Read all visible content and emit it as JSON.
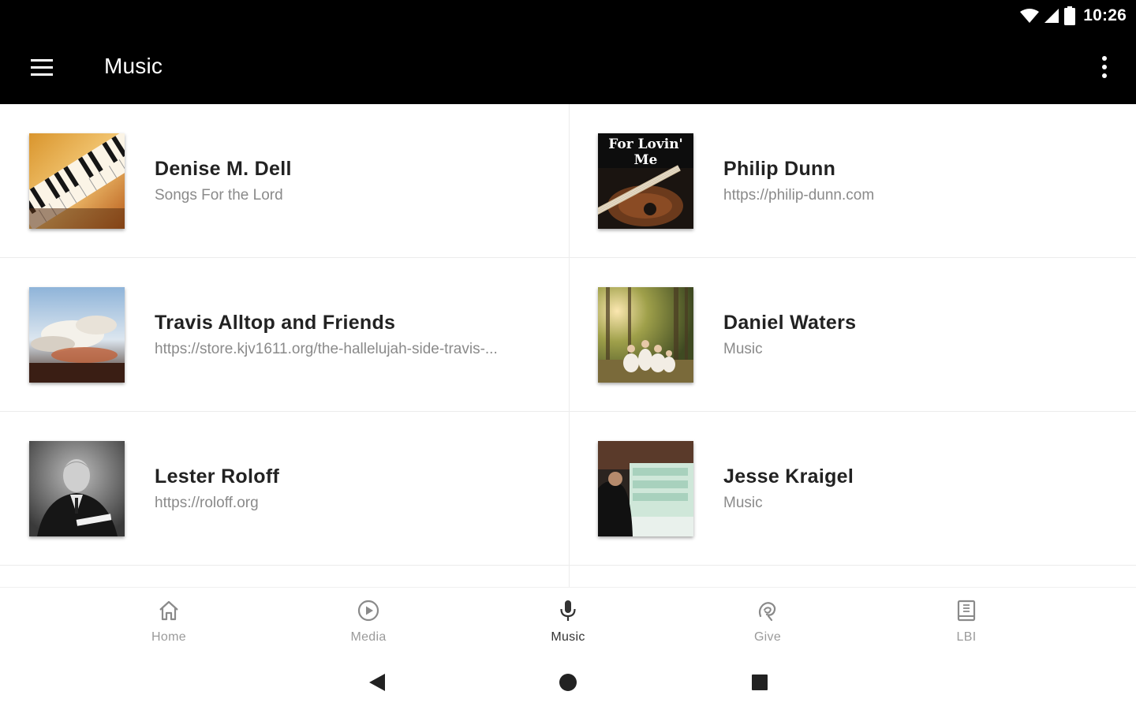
{
  "status_bar": {
    "time": "10:26",
    "icons": [
      "wifi-icon",
      "cell-signal-icon",
      "battery-icon"
    ]
  },
  "app_bar": {
    "title": "Music",
    "menu_icon": "hamburger-menu-icon",
    "more_icon": "more-vert-icon"
  },
  "items": [
    {
      "title": "Denise M. Dell",
      "subtitle": "Songs For the Lord",
      "cover": "piano-keys-album-art"
    },
    {
      "title": "Philip Dunn",
      "subtitle": "https://philip-dunn.com",
      "cover": "for-lovin-me-guitar-album-art"
    },
    {
      "title": "Travis Alltop and Friends",
      "subtitle": "https://store.kjv1611.org/the-hallelujah-side-travis-...",
      "cover": "sky-clouds-album-art"
    },
    {
      "title": "Daniel Waters",
      "subtitle": "Music",
      "cover": "family-forest-photo"
    },
    {
      "title": "Lester Roloff",
      "subtitle": "https://roloff.org",
      "cover": "man-portrait-bw-photo"
    },
    {
      "title": "Jesse Kraigel",
      "subtitle": "Music",
      "cover": "man-at-piano-photo"
    }
  ],
  "cover_texts": {
    "philip_dunn": "For Lovin' Me"
  },
  "bottom_nav": [
    {
      "label": "Home",
      "icon": "home-icon",
      "active": false
    },
    {
      "label": "Media",
      "icon": "play-circle-icon",
      "active": false
    },
    {
      "label": "Music",
      "icon": "microphone-icon",
      "active": true
    },
    {
      "label": "Give",
      "icon": "give-hand-icon",
      "active": false
    },
    {
      "label": "LBI",
      "icon": "book-icon",
      "active": false
    }
  ],
  "system_nav": [
    "back-icon",
    "home-circle-icon",
    "recents-square-icon"
  ],
  "colors": {
    "app_bar": "#000000",
    "title_text": "#222222",
    "subtitle_text": "#8a8a8a",
    "nav_inactive": "#9a9a9a",
    "nav_active": "#333333"
  }
}
